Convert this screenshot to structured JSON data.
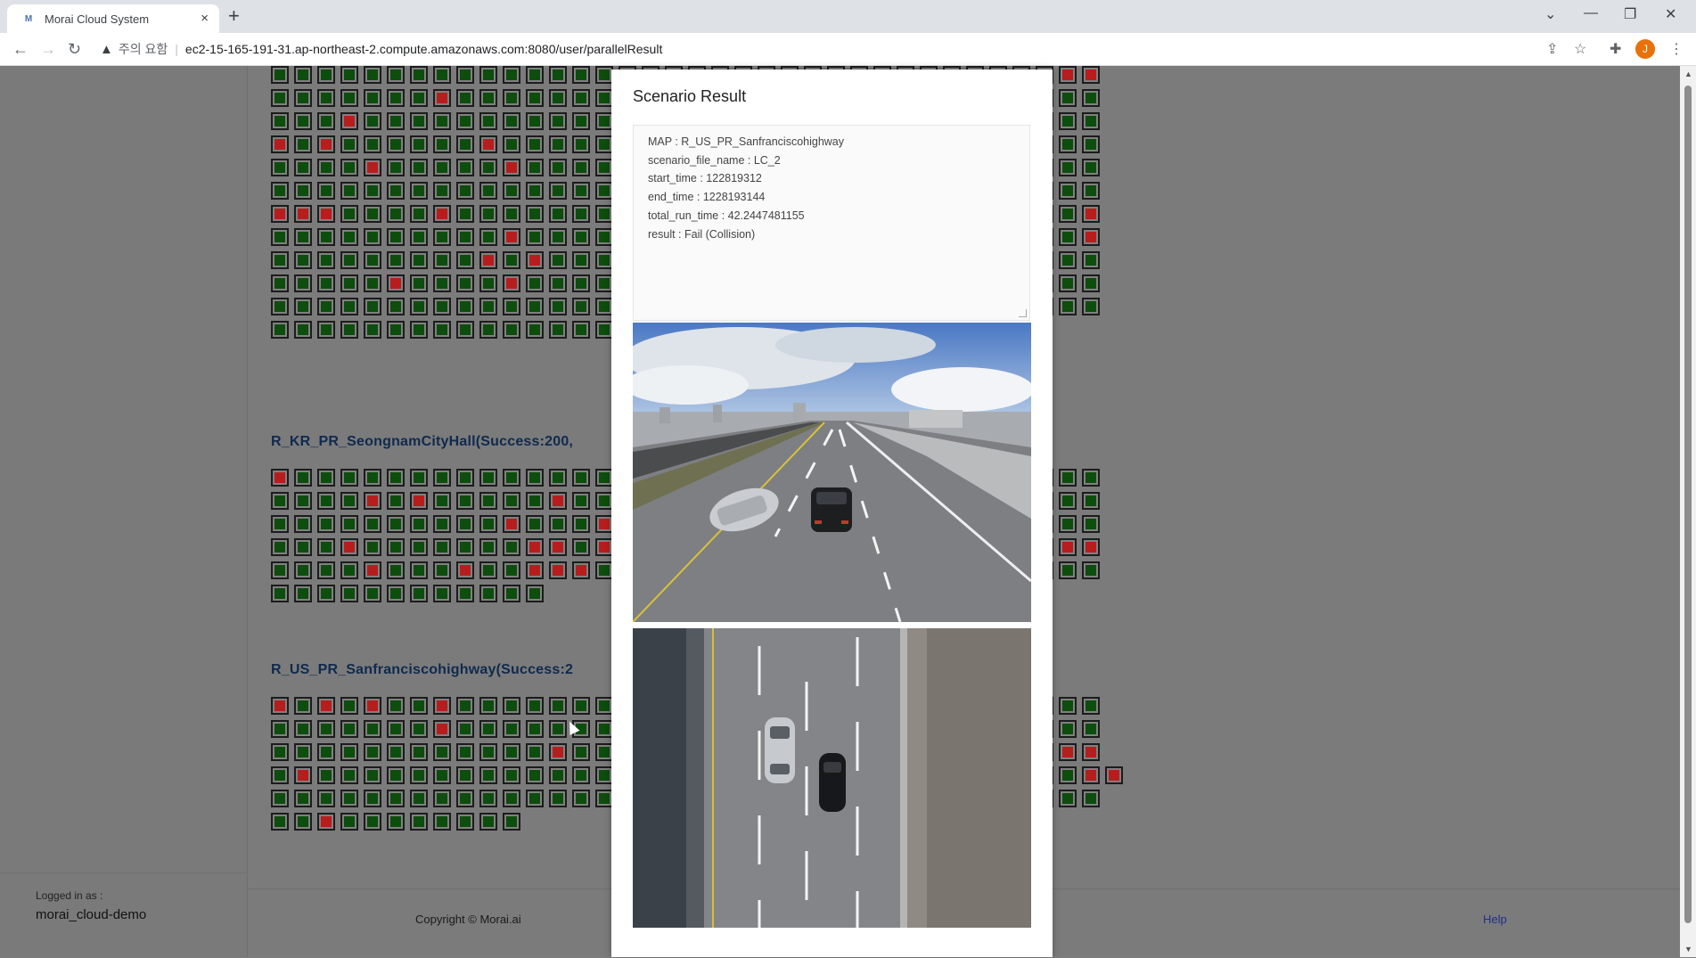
{
  "browser": {
    "tab_title": "Morai Cloud System",
    "favicon": "M",
    "tab_close": "×",
    "new_tab": "+",
    "security_label": "주의 요함",
    "url": "ec2-15-165-191-31.ap-northeast-2.compute.amazonaws.com:8080/user/parallelResult",
    "profile_initial": "J"
  },
  "sections": [
    {
      "title": "R_KR_PR_SeongnamCityHall(Success:200,"
    },
    {
      "title": "R_US_PR_Sanfranciscohighway(Success:2"
    }
  ],
  "grid_rows": {
    "top": [
      [
        1,
        1,
        1,
        1,
        1,
        1,
        1,
        1,
        1,
        1,
        1,
        1,
        1,
        1,
        1,
        1,
        1,
        1,
        1,
        1,
        1,
        1,
        0,
        1,
        1,
        1,
        1,
        0,
        1,
        1,
        1,
        1,
        0,
        1,
        0,
        0
      ],
      [
        1,
        1,
        1,
        1,
        1,
        1,
        1,
        0,
        1,
        1,
        1,
        1,
        1,
        1,
        1,
        1,
        1,
        0,
        1,
        1,
        1,
        1,
        1,
        1,
        1,
        1,
        1,
        1,
        1,
        1,
        1,
        0,
        1,
        0,
        1,
        1
      ],
      [
        1,
        1,
        1,
        0,
        1,
        1,
        1,
        1,
        1,
        1,
        1,
        1,
        1,
        1,
        1,
        1,
        1,
        1,
        1,
        1,
        1,
        0,
        1,
        1,
        1,
        1,
        1,
        1,
        1,
        1,
        1,
        0,
        1,
        1,
        1,
        1
      ],
      [
        0,
        1,
        0,
        1,
        1,
        1,
        1,
        1,
        1,
        0,
        1,
        1,
        1,
        1,
        1,
        1,
        1,
        1,
        1,
        1,
        1,
        0,
        1,
        1,
        1,
        1,
        1,
        1,
        1,
        1,
        1,
        1,
        1,
        1,
        1,
        1
      ],
      [
        1,
        1,
        1,
        1,
        0,
        1,
        1,
        1,
        1,
        1,
        0,
        1,
        1,
        1,
        1,
        0,
        1,
        1,
        0,
        1,
        1,
        1,
        1,
        1,
        1,
        1,
        1,
        1,
        1,
        1,
        1,
        1,
        1,
        1,
        1,
        1
      ],
      [
        1,
        1,
        1,
        1,
        1,
        1,
        1,
        1,
        1,
        1,
        1,
        1,
        1,
        1,
        1,
        1,
        1,
        1,
        1,
        1,
        1,
        0,
        1,
        1,
        1,
        1,
        1,
        1,
        0,
        1,
        1,
        1,
        1,
        1,
        1,
        1
      ],
      [
        0,
        0,
        0,
        1,
        1,
        1,
        1,
        0,
        1,
        1,
        1,
        1,
        1,
        1,
        1,
        1,
        1,
        1,
        1,
        1,
        1,
        1,
        1,
        1,
        1,
        1,
        1,
        1,
        1,
        1,
        1,
        1,
        1,
        1,
        1,
        0
      ],
      [
        1,
        1,
        1,
        1,
        1,
        1,
        1,
        1,
        1,
        1,
        0,
        1,
        1,
        1,
        1,
        0,
        0,
        1,
        0,
        1,
        1,
        1,
        1,
        1,
        1,
        1,
        1,
        1,
        1,
        1,
        1,
        1,
        1,
        1,
        1,
        0
      ],
      [
        1,
        1,
        1,
        1,
        1,
        1,
        1,
        1,
        1,
        0,
        1,
        0,
        1,
        1,
        1,
        1,
        1,
        1,
        0,
        1,
        1,
        1,
        1,
        1,
        1,
        0,
        1,
        1,
        1,
        1,
        1,
        1,
        1,
        1,
        1,
        1
      ],
      [
        1,
        1,
        1,
        1,
        1,
        0,
        1,
        1,
        1,
        1,
        0,
        1,
        1,
        1,
        1,
        1,
        1,
        1,
        1,
        1,
        1,
        1,
        1,
        1,
        1,
        1,
        1,
        1,
        1,
        1,
        1,
        1,
        1,
        1,
        1,
        1
      ],
      [
        1,
        1,
        1,
        1,
        1,
        1,
        1,
        1,
        1,
        1,
        1,
        1,
        1,
        1,
        1,
        1,
        1,
        1,
        1,
        1,
        1,
        1,
        1,
        1,
        1,
        1,
        1,
        1,
        1,
        1,
        1,
        1,
        1,
        1,
        1,
        1
      ],
      [
        1,
        1,
        1,
        1,
        1,
        1,
        1,
        1,
        1,
        1,
        1,
        1,
        1,
        1,
        1,
        1,
        1,
        1,
        1,
        1,
        1,
        1,
        0,
        1,
        1,
        1,
        1,
        1,
        1,
        1,
        1,
        1,
        1
      ]
    ],
    "seongnam": [
      [
        0,
        1,
        1,
        1,
        1,
        1,
        1,
        1,
        1,
        1,
        1,
        1,
        1,
        1,
        1,
        1,
        1,
        1,
        1,
        1,
        1,
        1,
        0,
        0,
        1,
        1,
        1,
        1,
        1,
        1,
        1,
        1,
        0,
        1,
        1,
        1
      ],
      [
        1,
        1,
        1,
        1,
        0,
        1,
        0,
        1,
        1,
        1,
        1,
        1,
        0,
        1,
        1,
        1,
        1,
        1,
        0,
        1,
        1,
        1,
        1,
        1,
        1,
        1,
        1,
        1,
        1,
        1,
        1,
        1,
        0,
        1,
        1,
        1
      ],
      [
        1,
        1,
        1,
        1,
        1,
        1,
        1,
        1,
        1,
        1,
        0,
        1,
        1,
        1,
        0,
        0,
        1,
        1,
        1,
        1,
        0,
        0,
        0,
        1,
        0,
        1,
        1,
        0,
        1,
        0,
        1,
        1,
        0,
        1,
        1,
        1
      ],
      [
        1,
        1,
        1,
        0,
        1,
        1,
        1,
        1,
        1,
        1,
        1,
        0,
        0,
        1,
        0,
        1,
        1,
        0,
        1,
        1,
        0,
        1,
        1,
        1,
        1,
        1,
        1,
        1,
        1,
        1,
        1,
        1,
        0,
        1,
        0,
        0
      ],
      [
        1,
        1,
        1,
        1,
        0,
        1,
        1,
        1,
        0,
        1,
        1,
        0,
        0,
        0,
        1,
        1,
        1,
        1,
        1,
        0,
        0,
        1,
        1,
        0,
        0,
        1,
        1,
        1,
        0,
        0,
        1,
        1,
        1,
        1,
        1,
        1
      ],
      [
        1,
        1,
        1,
        1,
        1,
        1,
        1,
        1,
        1,
        1,
        1,
        1
      ]
    ],
    "sanfrancisco": [
      [
        0,
        1,
        0,
        1,
        0,
        1,
        1,
        0,
        1,
        1,
        1,
        1,
        1,
        1,
        1,
        1,
        1,
        1,
        1,
        1,
        1,
        1,
        1,
        1,
        1,
        1,
        1,
        1,
        1,
        1,
        0,
        1,
        1,
        1,
        1,
        1
      ],
      [
        1,
        1,
        1,
        1,
        1,
        1,
        1,
        0,
        1,
        1,
        1,
        1,
        1,
        1,
        1,
        1,
        1,
        1,
        1,
        1,
        1,
        1,
        1,
        1,
        1,
        1,
        1,
        1,
        1,
        1,
        1,
        1,
        1,
        1,
        1,
        1
      ],
      [
        1,
        1,
        1,
        1,
        1,
        1,
        1,
        1,
        1,
        1,
        1,
        1,
        0,
        1,
        1,
        1,
        1,
        1,
        1,
        1,
        1,
        1,
        1,
        1,
        1,
        1,
        1,
        1,
        1,
        1,
        1,
        1,
        1,
        1,
        0,
        0
      ],
      [
        1,
        0,
        1,
        1,
        1,
        1,
        1,
        1,
        1,
        1,
        1,
        1,
        1,
        1,
        1,
        1,
        1,
        1,
        1,
        1,
        1,
        1,
        1,
        1,
        1,
        1,
        1,
        1,
        1,
        1,
        1,
        1,
        0,
        0,
        1,
        0,
        0
      ],
      [
        1,
        1,
        1,
        1,
        1,
        1,
        1,
        1,
        1,
        1,
        1,
        1,
        1,
        1,
        1,
        1,
        1,
        1,
        1,
        1,
        1,
        1,
        1,
        1,
        1,
        1,
        1,
        1,
        1,
        1,
        1,
        1,
        1,
        1,
        1,
        1
      ],
      [
        1,
        1,
        0,
        1,
        1,
        1,
        1,
        1,
        1,
        1,
        1
      ]
    ]
  },
  "sidebar": {
    "logged_in_label": "Logged in as :",
    "username": "morai_cloud-demo"
  },
  "footer": {
    "copyright": "Copyright © Morai.ai",
    "help": "Help"
  },
  "modal": {
    "title": "Scenario Result",
    "lines": [
      "MAP : R_US_PR_Sanfranciscohighway",
      "scenario_file_name : LC_2",
      "start_time : 122819312",
      "end_time : 1228193144",
      "total_run_time : 42.2447481155",
      "result : Fail (Collision)"
    ]
  },
  "colors": {
    "success": "#0d4d0d",
    "fail": "#b81d1d",
    "overlay_bg": "#7b7b7b"
  }
}
